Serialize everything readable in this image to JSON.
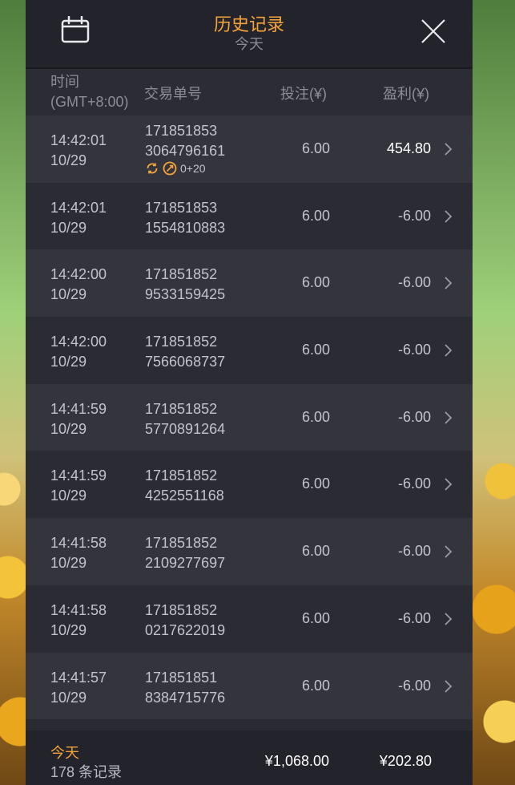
{
  "header": {
    "title": "历史记录",
    "subtitle": "今天"
  },
  "columns": {
    "time_line1": "时间",
    "time_line2": "(GMT+8:00)",
    "id": "交易单号",
    "bet": "投注(¥)",
    "profit": "盈利(¥)"
  },
  "rows": [
    {
      "time": "14:42:01",
      "date": "10/29",
      "id1": "171851853",
      "id2": "3064796161",
      "bet": "6.00",
      "profit": "454.80",
      "badge_text": "0+20"
    },
    {
      "time": "14:42:01",
      "date": "10/29",
      "id1": "171851853",
      "id2": "1554810883",
      "bet": "6.00",
      "profit": "-6.00"
    },
    {
      "time": "14:42:00",
      "date": "10/29",
      "id1": "171851852",
      "id2": "9533159425",
      "bet": "6.00",
      "profit": "-6.00"
    },
    {
      "time": "14:42:00",
      "date": "10/29",
      "id1": "171851852",
      "id2": "7566068737",
      "bet": "6.00",
      "profit": "-6.00"
    },
    {
      "time": "14:41:59",
      "date": "10/29",
      "id1": "171851852",
      "id2": "5770891264",
      "bet": "6.00",
      "profit": "-6.00"
    },
    {
      "time": "14:41:59",
      "date": "10/29",
      "id1": "171851852",
      "id2": "4252551168",
      "bet": "6.00",
      "profit": "-6.00"
    },
    {
      "time": "14:41:58",
      "date": "10/29",
      "id1": "171851852",
      "id2": "2109277697",
      "bet": "6.00",
      "profit": "-6.00"
    },
    {
      "time": "14:41:58",
      "date": "10/29",
      "id1": "171851852",
      "id2": "0217622019",
      "bet": "6.00",
      "profit": "-6.00"
    },
    {
      "time": "14:41:57",
      "date": "10/29",
      "id1": "171851851",
      "id2": "8384715776",
      "bet": "6.00",
      "profit": "-6.00"
    }
  ],
  "footer": {
    "period": "今天",
    "count": "178 条记录",
    "total_bet": "¥1,068.00",
    "total_profit": "¥202.80"
  },
  "colors": {
    "accent": "#f4a43a",
    "panel": "#2a2a33"
  },
  "icons": [
    "calendar-icon",
    "close-icon",
    "chevron-right-icon",
    "refresh-icon",
    "bonus-icon"
  ]
}
